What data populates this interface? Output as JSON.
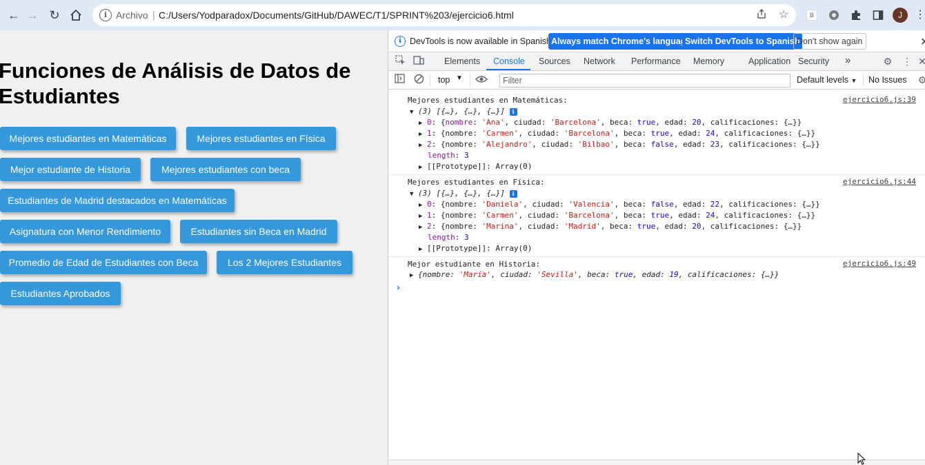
{
  "browser": {
    "scheme_label": "Archivo",
    "url": "C:/Users/Yodparadox/Documents/GitHub/DAWEC/T1/SPRINT%203/ejercicio6.html",
    "profile_initial": "J",
    "ext_badge": "B"
  },
  "page": {
    "title": "Funciones de Análisis de Datos de Estudiantes",
    "buttons": [
      "Mejores estudiantes en Matemáticas",
      "Mejores estudiantes en Física",
      "Mejor estudiante de Historia",
      "Mejores estudiantes con beca",
      "Estudiantes de Madrid destacados en Matemáticas",
      "Asignatura con Menor Rendimiento",
      "Estudiantes sin Beca en Madrid",
      "Promedio de Edad de Estudiantes con Beca",
      "Los 2 Mejores Estudiantes",
      "Estudiantes Aprobados"
    ]
  },
  "devtools": {
    "infobar": {
      "message": "DevTools is now available in Spanish!",
      "btn_match": "Always match Chrome's language",
      "btn_switch": "Switch DevTools to Spanish",
      "btn_dismiss": "Don't show again"
    },
    "tabs": [
      "Elements",
      "Console",
      "Sources",
      "Network",
      "Performance",
      "Memory",
      "Application",
      "Security"
    ],
    "active_tab": "Console",
    "more_tabs": "»",
    "toolbar": {
      "context": "top",
      "filter_placeholder": "Filter",
      "levels": "Default levels",
      "issues": "No Issues"
    },
    "console": {
      "groups": [
        {
          "title": "Mejores estudiantes en Matemáticas:",
          "source": "ejercicio6.js:39",
          "summary": "(3) [{…}, {…}, {…}]",
          "items": [
            {
              "idx": "0",
              "nombre": "'Ana'",
              "ciudad": "'Barcelona'",
              "beca": "true",
              "edad": "20"
            },
            {
              "idx": "1",
              "nombre": "'Carmen'",
              "ciudad": "'Barcelona'",
              "beca": "true",
              "edad": "24"
            },
            {
              "idx": "2",
              "nombre": "'Alejandro'",
              "ciudad": "'Bilbao'",
              "beca": "false",
              "edad": "23"
            }
          ],
          "length": "3",
          "proto": "[[Prototype]]: Array(0)"
        },
        {
          "title": "Mejores estudiantes en Física:",
          "source": "ejercicio6.js:44",
          "summary": "(3) [{…}, {…}, {…}]",
          "items": [
            {
              "idx": "0",
              "nombre": "'Daniela'",
              "ciudad": "'Valencia'",
              "beca": "false",
              "edad": "22"
            },
            {
              "idx": "1",
              "nombre": "'Carmen'",
              "ciudad": "'Barcelona'",
              "beca": "true",
              "edad": "24"
            },
            {
              "idx": "2",
              "nombre": "'Marina'",
              "ciudad": "'Madrid'",
              "beca": "true",
              "edad": "20"
            }
          ],
          "length": "3",
          "proto": "[[Prototype]]: Array(0)"
        }
      ],
      "historia": {
        "title": "Mejor estudiante en Historia:",
        "source": "ejercicio6.js:49",
        "nombre": "'María'",
        "ciudad": "'Sevilla'",
        "beca": "true",
        "edad": "19"
      }
    }
  }
}
